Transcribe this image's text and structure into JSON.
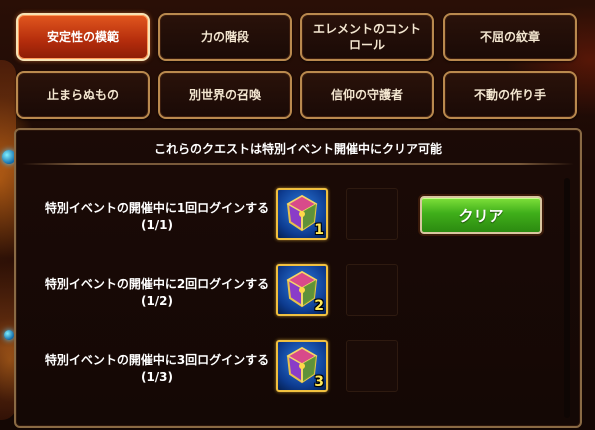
{
  "tabs": [
    {
      "label": "安定性の模範",
      "active": true
    },
    {
      "label": "力の階段",
      "active": false
    },
    {
      "label": "エレメントのコントロール",
      "active": false
    },
    {
      "label": "不屈の紋章",
      "active": false
    },
    {
      "label": "止まらぬもの",
      "active": false
    },
    {
      "label": "別世界の召喚",
      "active": false
    },
    {
      "label": "信仰の守護者",
      "active": false
    },
    {
      "label": "不動の作り手",
      "active": false
    }
  ],
  "panel": {
    "title": "これらのクエストは特別イベント開催中にクリア可能",
    "clear_label": "クリア"
  },
  "quests": [
    {
      "text": "特別イベントの開催中に1回ログインする",
      "progress": "(1/1)",
      "reward_count": "1"
    },
    {
      "text": "特別イベントの開催中に2回ログインする",
      "progress": "(1/2)",
      "reward_count": "2"
    },
    {
      "text": "特別イベントの開催中に3回ログインする",
      "progress": "(1/3)",
      "reward_count": "3"
    }
  ],
  "colors": {
    "active_tab": "#c8401a",
    "clear_button": "#3fae1a",
    "reward_border": "#f0c040"
  }
}
